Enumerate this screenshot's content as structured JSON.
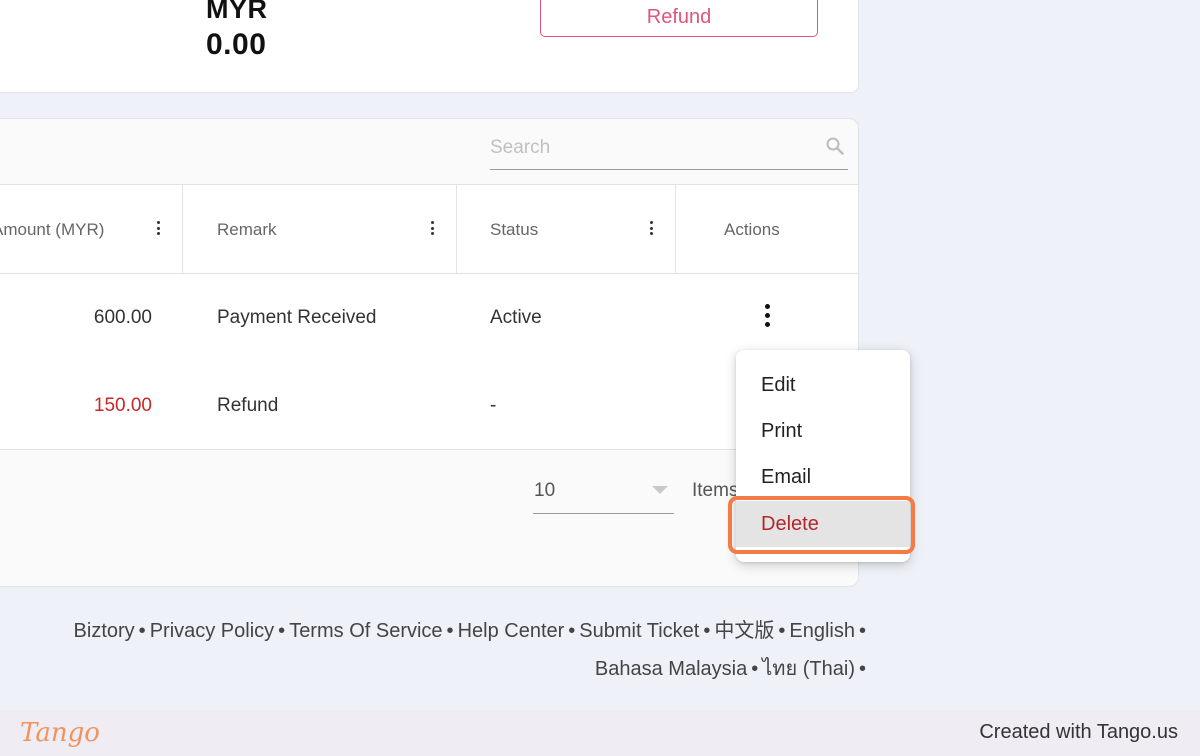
{
  "summary": {
    "currency": "MYR",
    "balance": "0.00",
    "refund_button": "Refund"
  },
  "search": {
    "placeholder": "Search"
  },
  "table": {
    "columns": [
      {
        "label": "Amount (MYR)"
      },
      {
        "label": "Remark"
      },
      {
        "label": "Status"
      },
      {
        "label": "Actions"
      }
    ],
    "rows": [
      {
        "amount": "600.00",
        "remark": "Payment Received",
        "status": "Active"
      },
      {
        "amount": "150.00",
        "remark": "Refund",
        "status": "-"
      }
    ],
    "colors": {
      "negative_amount": "#c62828"
    }
  },
  "pagination": {
    "page_size": "10",
    "items_label": "Items"
  },
  "action_menu": {
    "items": [
      "Edit",
      "Print",
      "Email",
      "Delete"
    ],
    "selected": "Delete",
    "highlight_color": "#f47a46"
  },
  "footer": {
    "links_line1": [
      "Biztory",
      "Privacy Policy",
      "Terms Of Service",
      "Help Center",
      "Submit Ticket",
      "中文版",
      "English"
    ],
    "links_line2": [
      "Bahasa Malaysia",
      "ไทย (Thai)"
    ],
    "separator": "•"
  },
  "tango": {
    "logo": "Tango",
    "created_with": "Created with Tango.us",
    "logo_color": "#f0935e"
  },
  "colors": {
    "accent_pink": "#e0557a",
    "page_bg": "#eef1f8"
  }
}
